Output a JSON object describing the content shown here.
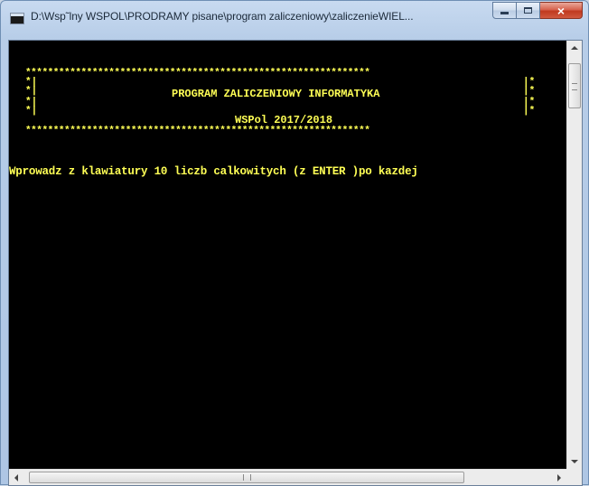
{
  "window": {
    "title": "D:\\Wsp˜lny WSPOL\\PRODRAMY pisane\\program zaliczeniowy\\zaliczenieWIEL...",
    "app_icon": "console-icon",
    "buttons": {
      "minimize": "minimize-icon",
      "maximize": "maximize-icon",
      "close": "×"
    }
  },
  "console": {
    "text_color": "#ffff55",
    "background": "#000000",
    "border_line": "**************************************************************",
    "box_left": "*|",
    "box_right": "|*",
    "header_title": "PROGRAM ZALICZENIOWY INFORMATYKA",
    "header_subtitle": "WSPol 2017/2018",
    "prompt": "Wprowadz z klawiatury 10 liczb calkowitych (z ENTER )po kazdej"
  },
  "scrollbars": {
    "vertical_position": 0,
    "horizontal_position": 0
  }
}
